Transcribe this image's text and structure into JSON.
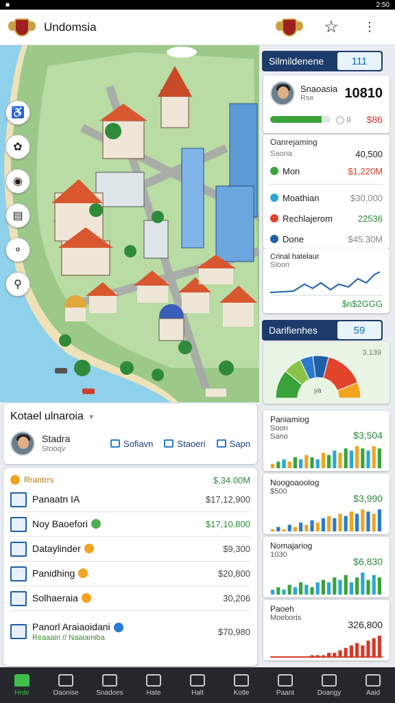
{
  "status_bar": {
    "right_text": "2:50"
  },
  "header": {
    "title": "Undomsia"
  },
  "map": {
    "tools": [
      "wheelchair-icon",
      "leaf-icon",
      "camera-icon",
      "document-icon",
      "microphone-icon",
      "search-icon"
    ]
  },
  "location_card": {
    "title": "Kotael ulnaroia",
    "user": {
      "name": "Stadra",
      "sub": "Stooqv"
    },
    "actions": [
      {
        "label": "Sofiavn",
        "icon": "map-icon"
      },
      {
        "label": "Staoeri",
        "icon": "cube-icon"
      },
      {
        "label": "Sapn",
        "icon": "chat-icon"
      }
    ]
  },
  "list_card": {
    "header_label": "Rrantrrs",
    "header_value": "$,34.00M",
    "rows": [
      {
        "label": "Panaatn IA",
        "value": "$17,12,900",
        "badge": "",
        "value_color": "#444444",
        "sub": ""
      },
      {
        "label": "Noy Baoefori",
        "value": "$17,10.800",
        "badge": "#4caf50",
        "value_color": "#2c8a3c",
        "sub": ""
      },
      {
        "label": "Dataylinder",
        "value": "$9,300",
        "badge": "#f2a31f",
        "value_color": "#444444",
        "sub": ""
      },
      {
        "label": "Panidhing",
        "value": "$20,800",
        "badge": "#f2a31f",
        "value_color": "#444444",
        "sub": ""
      },
      {
        "label": "Solhaeraia",
        "value": "30,206",
        "badge": "#f2a31f",
        "value_color": "#444444",
        "sub": ""
      },
      {
        "label": "Panorl Araiaoidani",
        "value": "$70,980",
        "badge": "#2a7ad0",
        "value_color": "#444444",
        "sub": "Reaaain // Naaiamiba"
      }
    ]
  },
  "right_top": {
    "banner_title": "Silmildenene",
    "banner_value": "111",
    "profile": {
      "name": "Snaoasia",
      "sub": "Rse",
      "score": "10810",
      "bar_fraction": 0.85,
      "mid": "0",
      "right": "$86"
    },
    "stats": {
      "head": "Oanrejaming",
      "head_sub": "Saona",
      "head_value": "40,500",
      "lines": [
        {
          "label": "Mon",
          "value": "$1,220M",
          "dot": "#3aa33a",
          "value_color": "#d23b2b"
        },
        {
          "label": "Moathian",
          "value": "$30,000",
          "dot": "#2aa6d9",
          "value_color": "#888888"
        },
        {
          "label": "Rechlajerom",
          "value": "22536",
          "dot": "#e0452b",
          "value_color": "#2c8a3c"
        },
        {
          "label": "Done",
          "value": "$45.30M",
          "dot": "#1e5fa8",
          "value_color": "#888888"
        }
      ]
    },
    "trend": {
      "title": "Crinal hatelaur",
      "sub": "Sioon",
      "value": "$n$2GGG"
    }
  },
  "right_bottom": {
    "banner_title": "Darifienhes",
    "banner_value": "59",
    "gauge_value": "3.139",
    "gauge_label": "ya",
    "gauge_segments": [
      22,
      14,
      10,
      12,
      30,
      12
    ],
    "gauge_colors": [
      "#3aa33a",
      "#8bc34a",
      "#2a7ad0",
      "#1e5fa8",
      "#e0452b",
      "#f2a31f"
    ],
    "charts": [
      {
        "title": "Paniamiog",
        "sub": "Soon",
        "sub2": "Sano",
        "value": "$3,504",
        "values": [
          2,
          3,
          4,
          3,
          5,
          4,
          6,
          5,
          4,
          7,
          6,
          8,
          7,
          9,
          8,
          10,
          9,
          8,
          10,
          9
        ],
        "colors": [
          "#f2a31f",
          "#3aa33a",
          "#2aa6d9"
        ]
      },
      {
        "title": "Noogoaoolog",
        "sub": "$500",
        "sub2": "",
        "value": "$3,990",
        "values": [
          1,
          2,
          1,
          3,
          2,
          4,
          3,
          5,
          4,
          6,
          7,
          6,
          8,
          7,
          9,
          8,
          10,
          9,
          8,
          10
        ],
        "colors": [
          "#f2a31f",
          "#2a7ad0"
        ]
      },
      {
        "title": "Nomajariog",
        "sub": "1030",
        "sub2": "",
        "value": "$6,830",
        "values": [
          2,
          3,
          2,
          4,
          3,
          5,
          4,
          3,
          5,
          6,
          5,
          7,
          6,
          8,
          5,
          7,
          9,
          6,
          8,
          7
        ],
        "colors": [
          "#2aa6d9",
          "#3aa33a"
        ]
      },
      {
        "title": "Paoeh",
        "sub": "Moeboris",
        "sub2": "",
        "value": "326,800",
        "values": [
          0,
          0,
          0,
          0,
          0,
          0,
          0,
          1,
          1,
          1,
          2,
          2,
          3,
          4,
          5,
          6,
          5,
          7,
          8,
          9
        ],
        "colors": [
          "#d23b2b"
        ]
      }
    ]
  },
  "bottom_nav": [
    {
      "label": "Hrde",
      "active": true
    },
    {
      "label": "Oaonise",
      "active": false
    },
    {
      "label": "Snadoes",
      "active": false
    },
    {
      "label": "Hate",
      "active": false
    },
    {
      "label": "Halt",
      "active": false
    },
    {
      "label": "Kotle",
      "active": false
    },
    {
      "label": "Paant",
      "active": false
    },
    {
      "label": "Doangy",
      "active": false
    },
    {
      "label": "Aaid",
      "active": false
    }
  ]
}
